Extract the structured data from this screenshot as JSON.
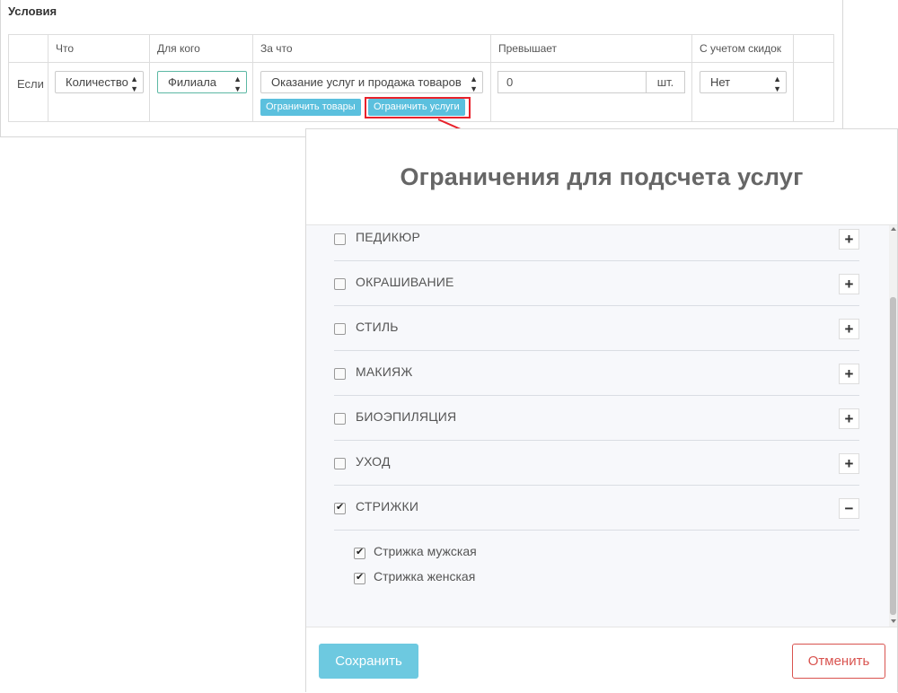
{
  "conditions": {
    "title": "Условия",
    "headers": [
      "Что",
      "Для кого",
      "За что",
      "Превышает",
      "С учетом скидок"
    ],
    "row_label": "Если",
    "what": "Количество",
    "for_whom": "Филиала",
    "for_what": "Оказание услуг и продажа товаров",
    "exceeds_value": "0",
    "unit": "шт.",
    "with_discounts": "Нет",
    "limit_goods_button": "Ограничить товары",
    "limit_services_button": "Ограничить услуги"
  },
  "modal": {
    "title": "Ограничения для подсчета услуг",
    "categories": [
      {
        "label": "ПЕДИКЮР",
        "checked": false,
        "expanded": false
      },
      {
        "label": "ОКРАШИВАНИЕ",
        "checked": false,
        "expanded": false
      },
      {
        "label": "СТИЛЬ",
        "checked": false,
        "expanded": false
      },
      {
        "label": "МАКИЯЖ",
        "checked": false,
        "expanded": false
      },
      {
        "label": "БИОЭПИЛЯЦИЯ",
        "checked": false,
        "expanded": false
      },
      {
        "label": "УХОД",
        "checked": false,
        "expanded": false
      },
      {
        "label": "СТРИЖКИ",
        "checked": true,
        "expanded": true
      }
    ],
    "sub_items": [
      {
        "label": "Стрижка мужская",
        "checked": true
      },
      {
        "label": "Стрижка женская",
        "checked": true
      }
    ],
    "save_label": "Сохранить",
    "cancel_label": "Отменить",
    "plus_symbol": "+",
    "minus_symbol": "−"
  },
  "colors": {
    "accent": "#5bc0de",
    "save": "#6dc9e0",
    "cancel": "#d9534f",
    "highlight": "#e8212b"
  }
}
